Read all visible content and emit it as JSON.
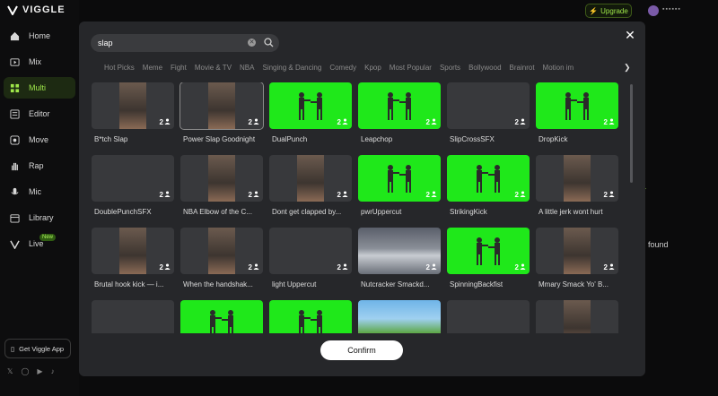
{
  "app": {
    "name": "VIGGLE"
  },
  "sidebar": {
    "items": [
      {
        "label": "Home",
        "icon": "home-icon"
      },
      {
        "label": "Mix",
        "icon": "play-icon"
      },
      {
        "label": "Multi",
        "icon": "multi-icon",
        "active": true
      },
      {
        "label": "Editor",
        "icon": "editor-icon"
      },
      {
        "label": "Move",
        "icon": "move-icon"
      },
      {
        "label": "Rap",
        "icon": "hand-icon"
      },
      {
        "label": "Mic",
        "icon": "mic-icon"
      },
      {
        "label": "Library",
        "icon": "library-icon"
      },
      {
        "label": "Live",
        "icon": "live-icon",
        "badge": "New"
      }
    ],
    "get_app": "Get Viggle App",
    "socials": [
      "x-icon",
      "instagram-icon",
      "youtube-icon",
      "tiktok-icon"
    ]
  },
  "header": {
    "upgrade": "Upgrade",
    "username": "▪▪▪▪▪▪"
  },
  "background": {
    "found_text": "found"
  },
  "modal": {
    "search": {
      "value": "slap"
    },
    "categories": [
      "Hot Picks",
      "Meme",
      "Fight",
      "Movie & TV",
      "NBA",
      "Singing & Dancing",
      "Comedy",
      "Kpop",
      "Most Popular",
      "Sports",
      "Bollywood",
      "Brainrot",
      "Motion im"
    ],
    "items": [
      {
        "title": "B*tch Slap",
        "count": "2",
        "style": "photo"
      },
      {
        "title": "Power Slap Goodnight",
        "count": "2",
        "style": "photo",
        "selected": true
      },
      {
        "title": "DualPunch",
        "count": "2",
        "style": "green"
      },
      {
        "title": "Leapchop",
        "count": "2",
        "style": "green"
      },
      {
        "title": "SlipCrossSFX",
        "count": "2",
        "style": "gray"
      },
      {
        "title": "DropKick",
        "count": "2",
        "style": "green"
      },
      {
        "title": "DoublePunchSFX",
        "count": "2",
        "style": "gray"
      },
      {
        "title": "NBA Elbow of the C...",
        "count": "2",
        "style": "photo"
      },
      {
        "title": "Dont get clapped by...",
        "count": "2",
        "style": "photo"
      },
      {
        "title": "pwrUppercut",
        "count": "2",
        "style": "green"
      },
      {
        "title": "StrikingKick",
        "count": "2",
        "style": "green"
      },
      {
        "title": "A little jerk wont hurt",
        "count": "2",
        "style": "photo"
      },
      {
        "title": "Brutal hook kick — i...",
        "count": "2",
        "style": "photo"
      },
      {
        "title": "When the handshak...",
        "count": "2",
        "style": "photo"
      },
      {
        "title": "light Uppercut",
        "count": "2",
        "style": "gray"
      },
      {
        "title": "Nutcracker Smackd...",
        "count": "2",
        "style": "ring"
      },
      {
        "title": "SpinningBackfist",
        "count": "2",
        "style": "green"
      },
      {
        "title": "Mmary Smack Yo' B...",
        "count": "2",
        "style": "photo"
      },
      {
        "title": "",
        "count": "",
        "style": "gray"
      },
      {
        "title": "",
        "count": "",
        "style": "green"
      },
      {
        "title": "",
        "count": "",
        "style": "green"
      },
      {
        "title": "",
        "count": "",
        "style": "cartoon"
      },
      {
        "title": "",
        "count": "",
        "style": "gray"
      },
      {
        "title": "",
        "count": "",
        "style": "photo"
      }
    ],
    "confirm": "Confirm"
  },
  "colors": {
    "accent": "#9fe84a",
    "green_screen": "#1fe81a",
    "modal_bg": "#26272a"
  }
}
